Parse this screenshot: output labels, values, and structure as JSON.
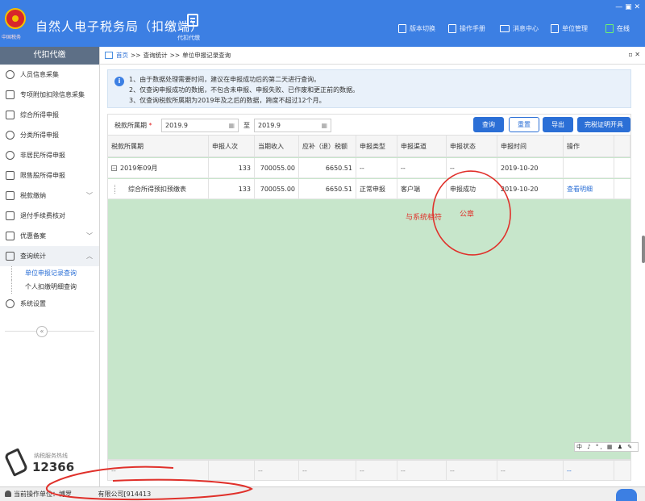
{
  "header": {
    "title": "自然人电子税务局（扣缴端）",
    "emblem_caption": "中国税务",
    "nav_label": "代扣代缴",
    "window_controls": "— ▣ ✕",
    "tools": [
      "版本切换",
      "操作手册",
      "消息中心",
      "单位管理",
      "在线"
    ],
    "online_color": "#6ef56e",
    "accent": "#3c7fe3"
  },
  "sidebar": {
    "header": "代扣代缴",
    "items": [
      {
        "label": "人员信息采集",
        "icon": "person-icon"
      },
      {
        "label": "专项附加扣除信息采集",
        "icon": "list-icon"
      },
      {
        "label": "综合所得申报",
        "icon": "layers-icon"
      },
      {
        "label": "分类所得申报",
        "icon": "clock-icon"
      },
      {
        "label": "非居民所得申报",
        "icon": "person-icon"
      },
      {
        "label": "限售股所得申报",
        "icon": "chart-icon"
      },
      {
        "label": "税款缴纳",
        "icon": "folder-icon",
        "chevron": "﹀"
      },
      {
        "label": "退付手续费核对",
        "icon": "receipt-icon"
      },
      {
        "label": "优惠备案",
        "icon": "document-icon",
        "chevron": "﹀"
      },
      {
        "label": "查询统计",
        "icon": "search-icon",
        "chevron": "︿"
      }
    ],
    "sub_items": [
      "单位申报记录查询",
      "个人扣缴明细查询"
    ],
    "settings": "系统设置",
    "collapse": "«",
    "hotline_label": "纳税服务热线",
    "hotline_number": "12366"
  },
  "breadcrumb": {
    "home": "首页",
    "sep": ">>",
    "items": [
      "查询统计",
      "单位申报记录查询"
    ],
    "controls": "▫ ✕"
  },
  "notice": {
    "icon": "i",
    "lines": [
      "1、由于数据处理需要时间，建议在申报成功后的第二天进行查询。",
      "2、仅查询申报成功的数据，不包含未申报、申报失败、已作废和更正前的数据。",
      "3、仅查询税款所属期为2019年及之后的数据，跨度不超过12个月。"
    ]
  },
  "filter": {
    "label": "税款所属期",
    "required_mark": "*",
    "from": "2019.9",
    "to_sep": "至",
    "to": "2019.9",
    "calendar_glyph": "▦",
    "buttons": {
      "query": "查询",
      "reset": "重置",
      "export": "导出",
      "certificate": "完税证明开具"
    }
  },
  "table": {
    "columns": [
      "税款所属期",
      "申报人次",
      "当期收入",
      "应补（退）税额",
      "申报类型",
      "申报渠道",
      "申报状态",
      "申报时间",
      "操作"
    ],
    "rows": [
      {
        "period": "2019年09月",
        "toggle": "−",
        "persons": "133",
        "income": "700055.00",
        "tax": "6650.51",
        "type": "--",
        "channel": "--",
        "status": "--",
        "time": "2019-10-20",
        "op": ""
      },
      {
        "period": "综合所得预扣预缴表",
        "persons": "133",
        "income": "700055.00",
        "tax": "6650.51",
        "type": "正常申报",
        "channel": "客户端",
        "status": "申报成功",
        "time": "2019-10-20",
        "op": "查看明细"
      }
    ],
    "footer": [
      "--",
      "",
      "--",
      "--",
      "--",
      "--",
      "--",
      "--",
      "--"
    ],
    "body_color": "#c7e6cb"
  },
  "ime_bar": "中 ♪ °, ▦ ♟ ✎",
  "annotations": {
    "match_text": "与系统相符",
    "seal_text": "公章",
    "ink_color": "#e0302a"
  },
  "statusbar": {
    "label": "当前操作单位：",
    "unit_prefix": "博罗",
    "unit_suffix": "有限公司[914413"
  }
}
